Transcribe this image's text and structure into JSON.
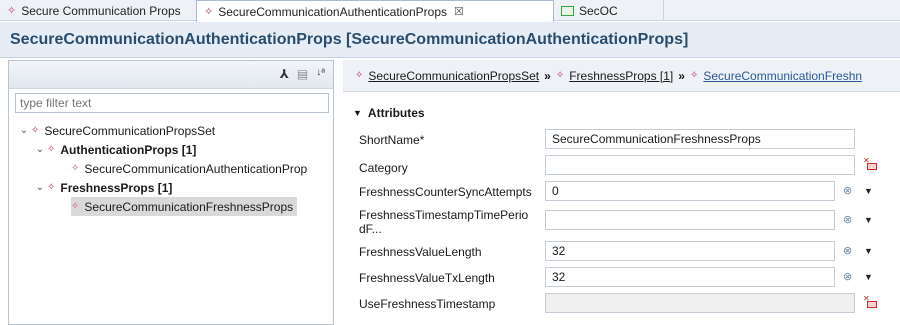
{
  "tabs": [
    {
      "label": "Secure Communication Props",
      "icon": "gem-icon"
    },
    {
      "label": "SecureCommunicationAuthenticationProps",
      "icon": "gem-icon",
      "close": "☒"
    },
    {
      "label": "SecOC",
      "icon": "package-icon"
    }
  ],
  "editor": {
    "title": "SecureCommunicationAuthenticationProps [SecureCommunicationAuthenticationProps]"
  },
  "outline": {
    "filter_placeholder": "type filter text",
    "tree": [
      {
        "label": "SecureCommunicationPropsSet"
      },
      {
        "label": "AuthenticationProps [1]"
      },
      {
        "label": "SecureCommunicationAuthenticationProp"
      },
      {
        "label": "FreshnessProps [1]"
      },
      {
        "label": "SecureCommunicationFreshnessProps"
      }
    ]
  },
  "breadcrumb": {
    "items": [
      "SecureCommunicationPropsSet",
      "FreshnessProps [1]",
      "SecureCommunicationFreshn"
    ]
  },
  "attributes": {
    "section_title": "Attributes",
    "fields": [
      {
        "label": "ShortName*",
        "value": ""
      },
      {
        "label": "Category",
        "value": ""
      },
      {
        "label": "FreshnessCounterSyncAttempts",
        "value": "0"
      },
      {
        "label": "FreshnessTimestampTimePerio dF...",
        "value": ""
      },
      {
        "label": "FreshnessValueLength",
        "value": "32"
      },
      {
        "label": "FreshnessValueTxLength",
        "value": "32"
      },
      {
        "label": "UseFreshnessTimestamp",
        "value": ""
      }
    ],
    "shortname_value": "SecureCommunicationFreshnessProps"
  },
  "colors": {
    "title": "#2a4d6e",
    "selection": "#d9d9d9",
    "gem": "#b9327a",
    "link": "#2a5a9a"
  }
}
